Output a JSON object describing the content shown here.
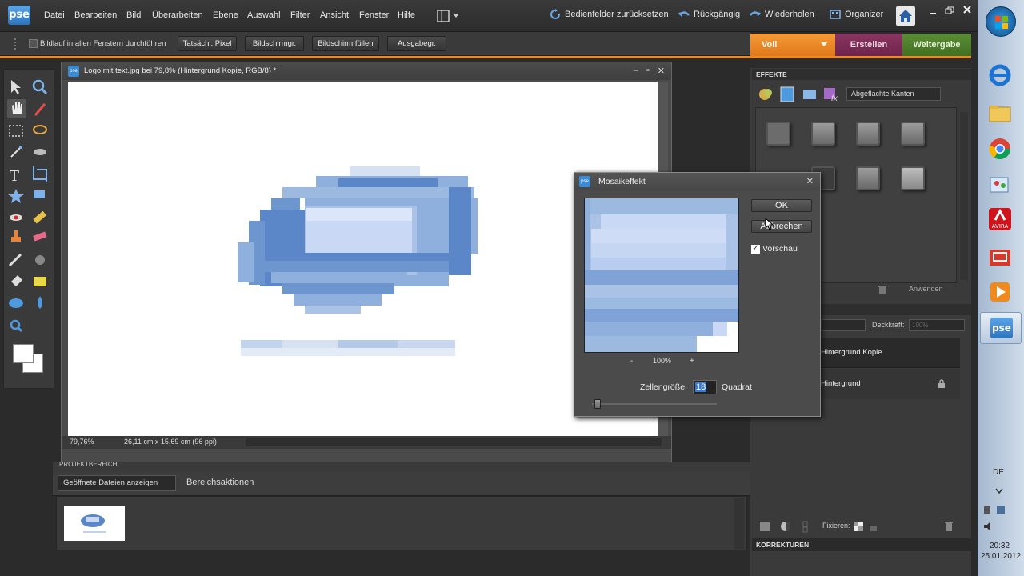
{
  "app": {
    "logo": "pse"
  },
  "menu": {
    "items": [
      "Datei",
      "Bearbeiten",
      "Bild",
      "Überarbeiten",
      "Ebene",
      "Auswahl",
      "Filter",
      "Ansicht",
      "Fenster",
      "Hilfe"
    ],
    "reset_panels": "Bedienfelder zurücksetzen",
    "undo": "Rückgängig",
    "redo": "Wiederholen",
    "organizer": "Organizer"
  },
  "options_bar": {
    "scroll_all_label": "Bildlauf in allen Fenstern durchführen",
    "buttons": [
      "Tatsächl. Pixel",
      "Bildschirmgr.",
      "Bildschirm füllen",
      "Ausgabegr."
    ]
  },
  "mode_tabs": {
    "full": "Voll",
    "create": "Erstellen",
    "share": "Weitergabe"
  },
  "document": {
    "title": "Logo mit text.jpg bei 79,8% (Hintergrund Kopie, RGB/8) *",
    "zoom": "79,76%",
    "size": "26,11 cm x 15,69 cm (96 ppi)"
  },
  "project_bin": {
    "title": "PROJEKTBEREICH",
    "dropdown": "Geöffnete Dateien anzeigen",
    "actions": "Bereichsaktionen"
  },
  "effects_panel": {
    "header": "EFFEKTE",
    "category": "Abgeflachte Kanten",
    "apply": "Anwenden"
  },
  "layers_panel": {
    "opacity_label": "Deckkraft:",
    "opacity_value": "100%",
    "layers": [
      "Hintergrund Kopie",
      "Hintergrund"
    ],
    "lock_label": "Fixieren:"
  },
  "corrections_panel": {
    "header": "KORREKTUREN"
  },
  "dialog": {
    "title": "Mosaikeffekt",
    "ok": "OK",
    "cancel": "Abbrechen",
    "preview_label": "Vorschau",
    "preview_checked": true,
    "zoom_minus": "-",
    "zoom": "100%",
    "zoom_plus": "+",
    "cell_size_label": "Zellengröße:",
    "cell_size": "18",
    "cell_unit": "Quadrat"
  },
  "taskbar": {
    "language": "DE",
    "time": "20:32",
    "date": "25.01.2012"
  },
  "colors": {
    "accent_orange": "#e98a26",
    "tab_create": "#7a2b53",
    "tab_share": "#4c7d28",
    "logo_blue": "#5b87c8"
  }
}
